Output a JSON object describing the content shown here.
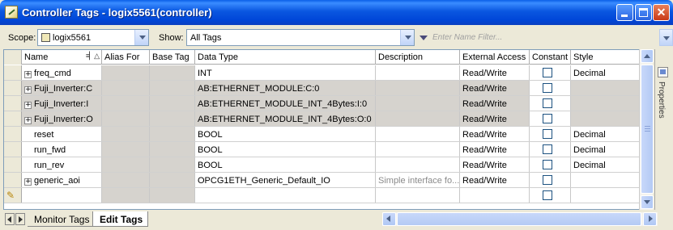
{
  "window": {
    "title": "Controller Tags - logix5561(controller)",
    "colors": {
      "titlebar": "#0a57e0",
      "grid_shade": "#d6d3ce",
      "window_bg": "#ece9d8"
    }
  },
  "toolbar": {
    "scope_label": "Scope:",
    "scope_value": "logix5561",
    "show_label": "Show:",
    "show_value": "All Tags",
    "filter_placeholder": "Enter Name Filter..."
  },
  "table": {
    "columns": [
      "Name",
      "Alias For",
      "Base Tag",
      "Data Type",
      "Description",
      "External Access",
      "Constant",
      "Style"
    ],
    "rows": [
      {
        "name": "freq_cmd",
        "expandable": true,
        "alias_for": "",
        "base_tag": "",
        "data_type": "INT",
        "description": "",
        "external_access": "Read/Write",
        "constant": false,
        "style": "Decimal",
        "shaded": false
      },
      {
        "name": "Fuji_Inverter:C",
        "expandable": true,
        "alias_for": "",
        "base_tag": "",
        "data_type": "AB:ETHERNET_MODULE:C:0",
        "description": "",
        "external_access": "Read/Write",
        "constant": false,
        "style": "",
        "shaded": true
      },
      {
        "name": "Fuji_Inverter:I",
        "expandable": true,
        "alias_for": "",
        "base_tag": "",
        "data_type": "AB:ETHERNET_MODULE_INT_4Bytes:I:0",
        "description": "",
        "external_access": "Read/Write",
        "constant": false,
        "style": "",
        "shaded": true
      },
      {
        "name": "Fuji_Inverter:O",
        "expandable": true,
        "alias_for": "",
        "base_tag": "",
        "data_type": "AB:ETHERNET_MODULE_INT_4Bytes:O:0",
        "description": "",
        "external_access": "Read/Write",
        "constant": false,
        "style": "",
        "shaded": true
      },
      {
        "name": "reset",
        "expandable": false,
        "alias_for": "",
        "base_tag": "",
        "data_type": "BOOL",
        "description": "",
        "external_access": "Read/Write",
        "constant": false,
        "style": "Decimal",
        "shaded": false
      },
      {
        "name": "run_fwd",
        "expandable": false,
        "alias_for": "",
        "base_tag": "",
        "data_type": "BOOL",
        "description": "",
        "external_access": "Read/Write",
        "constant": false,
        "style": "Decimal",
        "shaded": false
      },
      {
        "name": "run_rev",
        "expandable": false,
        "alias_for": "",
        "base_tag": "",
        "data_type": "BOOL",
        "description": "",
        "external_access": "Read/Write",
        "constant": false,
        "style": "Decimal",
        "shaded": false
      },
      {
        "name": "generic_aoi",
        "expandable": true,
        "alias_for": "",
        "base_tag": "",
        "data_type": "OPCG1ETH_Generic_Default_IO",
        "description": "Simple interface fo...",
        "external_access": "Read/Write",
        "constant": false,
        "style": "",
        "shaded": false
      },
      {
        "name": "",
        "expandable": false,
        "alias_for": "",
        "base_tag": "",
        "data_type": "",
        "description": "",
        "external_access": "",
        "constant": false,
        "style": "",
        "shaded": false,
        "new_row": true
      }
    ]
  },
  "side_panel": {
    "label": "Properties"
  },
  "tabs": [
    "Monitor Tags",
    "Edit Tags"
  ],
  "expander_glyph": "+",
  "new_row_glyph": "✎",
  "icons": [
    "app-icon",
    "minimize-icon",
    "maximize-icon",
    "close-icon",
    "scope-icon",
    "filter-icon",
    "dropdown-arrow-icon",
    "expander-icon",
    "pencil-icon",
    "properties-icon",
    "scroll-arrow-icon"
  ]
}
